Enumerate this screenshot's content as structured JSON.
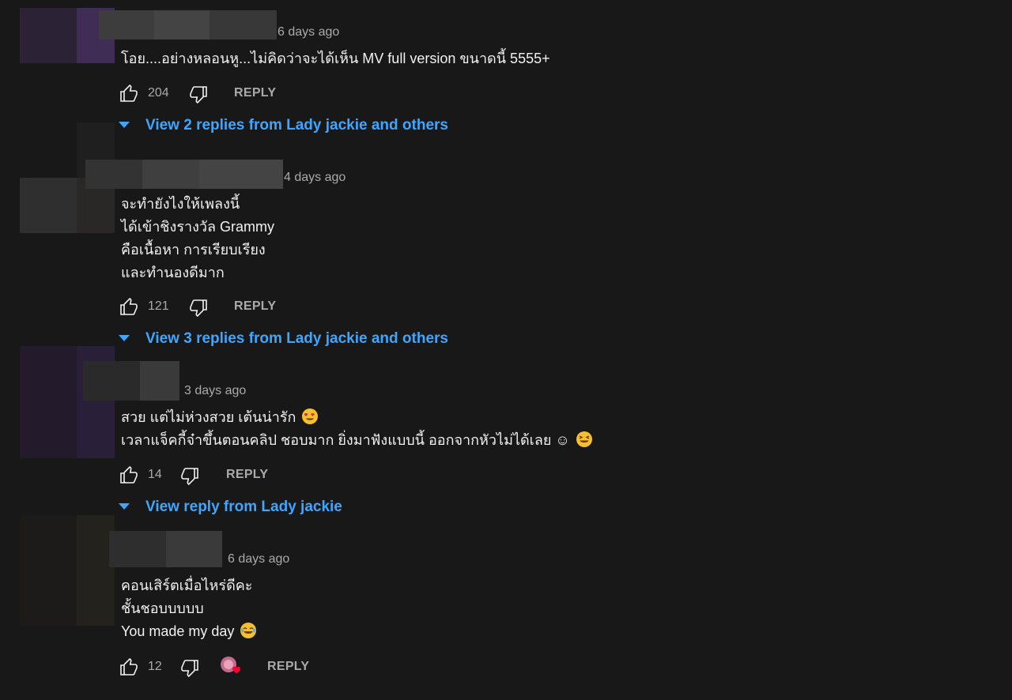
{
  "comments": [
    {
      "time": "6 days ago",
      "lines": [
        "โอย....อย่างหลอนหู...ไม่คิดว่าจะได้เห็น MV full version ขนาดนี้ 5555+"
      ],
      "likes": "204",
      "reply_label": "REPLY",
      "replies_link": "View 2 replies from Lady jackie and others"
    },
    {
      "time": "4 days ago",
      "lines": [
        "จะทำยังไงให้เพลงนี้",
        "ได้เข้าชิงรางวัล Grammy",
        "คือเนื้อหา การเรียบเรียง",
        "และทำนองดีมาก"
      ],
      "likes": "121",
      "reply_label": "REPLY",
      "replies_link": "View 3 replies from Lady jackie and others"
    },
    {
      "time": "3 days ago",
      "lines": [
        "สวย แต่ไม่ห่วงสวย เต้นน่ารัก",
        "เวลาแจ็คกี้จ๋าขึ้นตอนคลิป ชอบมาก ยิ่งมาฟังแบบนี้ ออกจากหัวไม่ได้เลย ☺"
      ],
      "likes": "14",
      "reply_label": "REPLY",
      "replies_link": "View reply from Lady jackie"
    },
    {
      "time": "6 days ago",
      "lines": [
        "คอนเสิร์ตเมื่อไหร่ดีคะ",
        "ชั้นชอบบบบบ",
        "You made my day"
      ],
      "likes": "12",
      "reply_label": "REPLY"
    }
  ],
  "icons": {
    "like": "thumbs-up-icon",
    "dislike": "thumbs-down-icon",
    "expand": "caret-down-icon",
    "creator_heart": "creator-heart-icon"
  },
  "colors": {
    "background": "#181818",
    "link": "#3ea6ff",
    "text": "#f1f1f1",
    "secondary": "#aaaaaa"
  }
}
